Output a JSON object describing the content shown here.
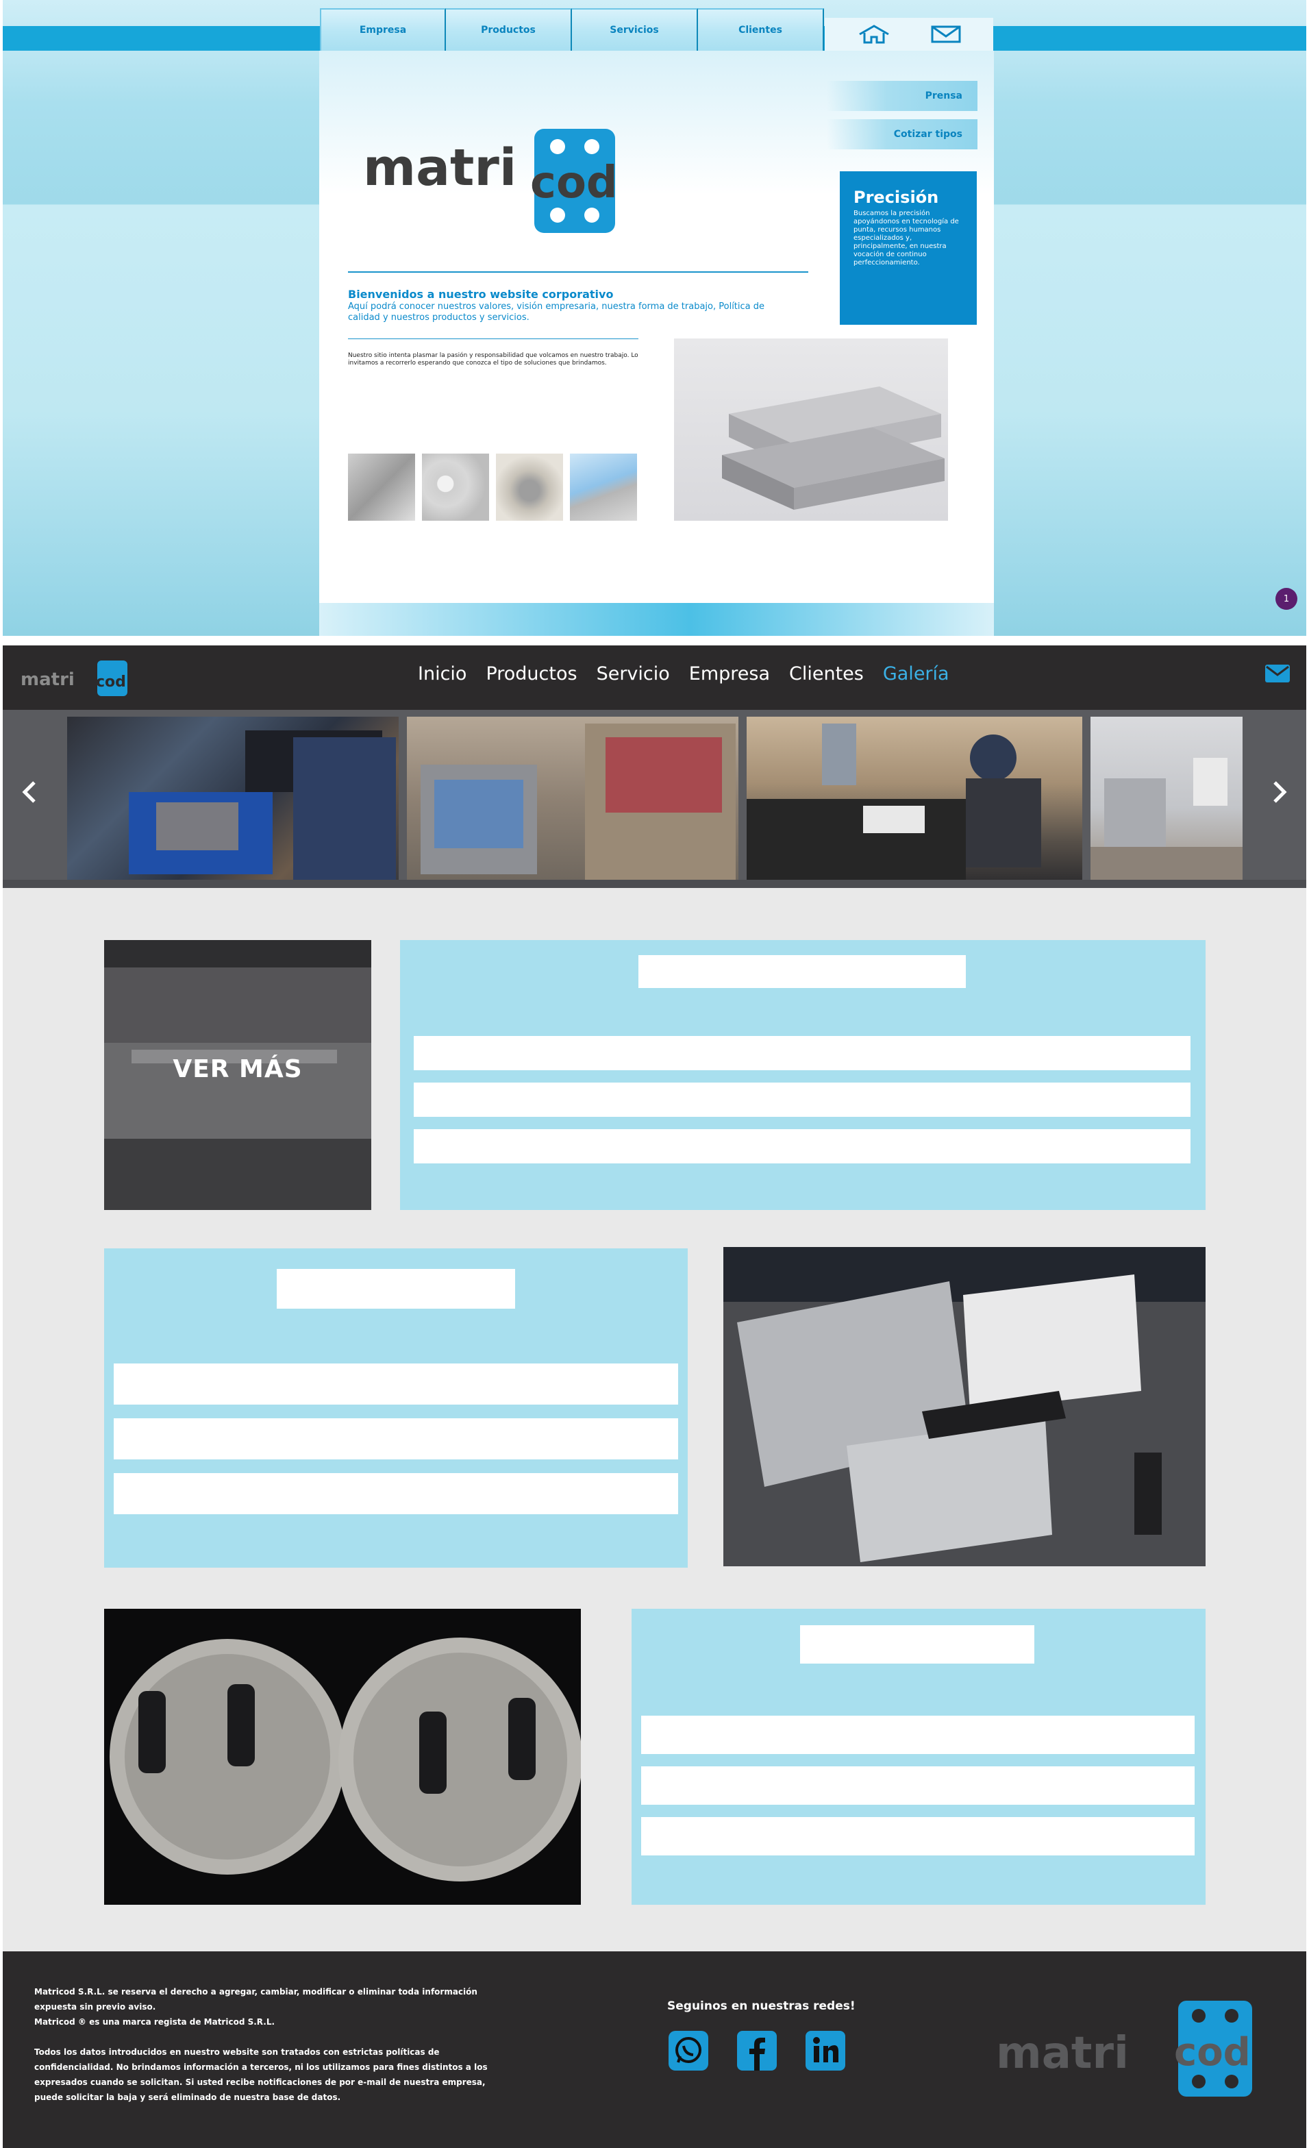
{
  "old_site": {
    "nav_tabs": [
      "Empresa",
      "Productos",
      "Servicios",
      "Clientes"
    ],
    "side_buttons": {
      "prensa": "Prensa",
      "cotizar": "Cotizar tipos"
    },
    "precision": {
      "title": "Precisión",
      "text": "Buscamos la precisión apoyándonos en tecnología de punta, recursos humanos especializados y, principalmente, en nuestra vocación de continuo perfeccionamiento."
    },
    "logo_text": {
      "left": "matri",
      "right": "cod"
    },
    "welcome": {
      "title": "Bienvenidos a nuestro website corporativo",
      "subtitle": "Aquí podrá conocer nuestros valores, visión empresaria, nuestra forma de trabajo, Política de calidad y nuestros productos y servicios."
    },
    "intro": "Nuestro sitio intenta plasmar la pasión y responsabilidad que volcamos en nuestro trabajo. Lo invitamos a recorrerlo esperando que conozca el tipo de soluciones que brindamos.",
    "badge": "1",
    "colors": {
      "accent": "#0a8acb",
      "topbar": "#17a6d9"
    }
  },
  "new_nav": {
    "logo_text": {
      "left": "matri",
      "right": "cod"
    },
    "items": [
      "Inicio",
      "Productos",
      "Servicio",
      "Empresa",
      "Clientes",
      "Galería"
    ],
    "active": "Galería",
    "mail_icon": "mail-icon",
    "colors": {
      "background": "#2c2a2b",
      "active": "#3bb1e6"
    }
  },
  "carousel": {
    "prev_icon": "chevron-left-icon",
    "next_icon": "chevron-right-icon"
  },
  "content": {
    "ver_mas": "VER MÁS",
    "colors": {
      "card": "#a8dfee",
      "background": "#e9e9e9"
    }
  },
  "footer": {
    "legal_1": "Matricod S.R.L. se reserva el derecho a agregar, cambiar, modificar o eliminar toda información expuesta sin previo aviso.",
    "legal_2": "Matricod ® es una marca regista de Matricod S.R.L.",
    "legal_3": "Todos los datos introducidos en nuestro website son tratados con estrictas políticas de confidencialidad. No brindamos información a terceros, ni los utilizamos para fines distintos a los expresados cuando se solicitan. Si usted recibe notificaciones de por e-mail de nuestra empresa, puede solicitar la baja y será eliminado de nuestra base de datos.",
    "social_title": "Seguinos en nuestras redes!",
    "social_icons": [
      "whatsapp-icon",
      "facebook-icon",
      "linkedin-icon"
    ],
    "logo_text": {
      "left": "matri",
      "right": "cod"
    }
  }
}
